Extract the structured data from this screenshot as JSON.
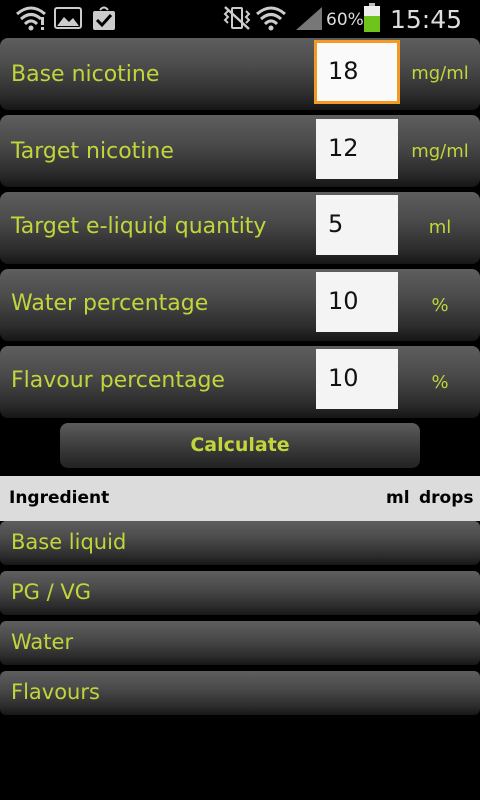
{
  "status_bar": {
    "battery_percent": "60%",
    "time": "15:45",
    "battery_level": 0.6
  },
  "form": {
    "rows": [
      {
        "label": "Base nicotine",
        "value": "18",
        "unit": "mg/ml"
      },
      {
        "label": "Target nicotine",
        "value": "12",
        "unit": "mg/ml"
      },
      {
        "label": "Target e-liquid quantity",
        "value": "5",
        "unit": "ml"
      },
      {
        "label": "Water percentage",
        "value": "10",
        "unit": "%"
      },
      {
        "label": "Flavour percentage",
        "value": "10",
        "unit": "%"
      }
    ],
    "calculate_label": "Calculate"
  },
  "results": {
    "headers": {
      "ingredient": "Ingredient",
      "ml": "ml",
      "drops": "drops"
    },
    "rows": [
      "Base liquid",
      "PG / VG",
      "Water",
      "Flavours"
    ]
  },
  "colors": {
    "label_green": "#c2d53a",
    "focus_orange": "#f39a26",
    "header_bg": "#dcdcdc",
    "background": "#000000"
  },
  "icons": [
    "wifi-alert-icon",
    "gallery-icon",
    "task-done-icon",
    "vibrate-mute-icon",
    "wifi-signal-icon",
    "cell-signal-icon",
    "battery-icon"
  ]
}
